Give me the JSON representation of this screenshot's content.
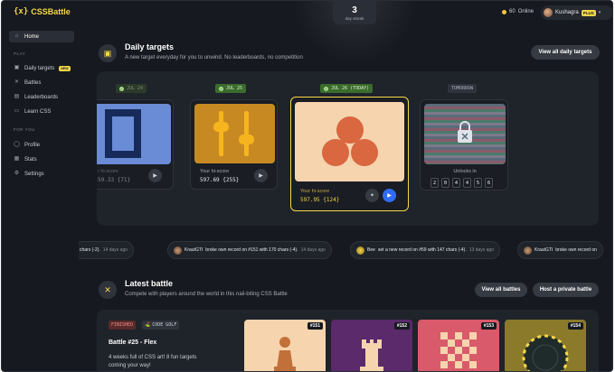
{
  "app": {
    "name": "CSSBattle",
    "logo_mark": "{x}"
  },
  "streak": {
    "count": "3",
    "label": "day streak"
  },
  "online": {
    "count": "60",
    "label": "Online"
  },
  "user": {
    "name": "Kushagra",
    "badge": "PLUS"
  },
  "sidebar": {
    "home": "Home",
    "play_section": "PLAY",
    "play_items": [
      {
        "label": "Daily targets",
        "badge": "NEW",
        "icon": "calendar-icon"
      },
      {
        "label": "Battles",
        "icon": "swords-icon"
      },
      {
        "label": "Leaderboards",
        "icon": "leaderboard-icon"
      },
      {
        "label": "Learn CSS",
        "icon": "book-icon"
      }
    ],
    "you_section": "FOR YOU",
    "you_items": [
      {
        "label": "Profile",
        "icon": "user-icon"
      },
      {
        "label": "Stats",
        "icon": "stats-icon"
      },
      {
        "label": "Settings",
        "icon": "gear-icon"
      }
    ]
  },
  "daily": {
    "title": "Daily targets",
    "subtitle": "A new target everyday for you to unwind. No leaderboards, no competition",
    "view_all": "View all daily targets",
    "cards": [
      {
        "tag": "JUL 24",
        "hi_label": "r hi-score",
        "hi_score": "59.33 {71}"
      },
      {
        "tag": "JUL 25",
        "hi_label": "Your hi-score",
        "hi_score": "597.69 {255}"
      },
      {
        "tag": "JUL 26 (TODAY)",
        "hi_label": "Your hi-score",
        "hi_score": "597.95 {124}"
      },
      {
        "tag": "TOMORROW",
        "unlock_label": "Unlocks in",
        "countdown": [
          "2",
          "0",
          "4",
          "4",
          "5",
          "6"
        ]
      }
    ]
  },
  "ticker": [
    {
      "text": "chars (-2).",
      "ago": "14 days ago"
    },
    {
      "user": "KrautGTI",
      "text": "broke own record on #151 with 170 chars (-4).",
      "ago": "14 days ago"
    },
    {
      "user": "Bee",
      "text": "set a new record on #59 with 147 chars (-4).",
      "ago": "13 days ago"
    },
    {
      "user": "KrautGTI",
      "text": "broke own record on",
      "ago": ""
    }
  ],
  "battle": {
    "title": "Latest battle",
    "subtitle": "Compete with players around the world in this nail-biting CSS Battle",
    "view_all": "View all battles",
    "host": "Host a private battle",
    "status": "FINISHED",
    "mode": "CODE GOLF",
    "name": "Battle #25 - Flex",
    "desc_line1": "4 weeks full of CSS art! 8 fun targets",
    "desc_line2": "coming your way!",
    "targets": [
      "#151",
      "#152",
      "#153",
      "#154"
    ]
  },
  "colors": {
    "accent": "#f5d84a",
    "bg": "#16191f",
    "panel": "#1f232a",
    "success": "#3b6b2d",
    "play_blue": "#2f6df6"
  }
}
